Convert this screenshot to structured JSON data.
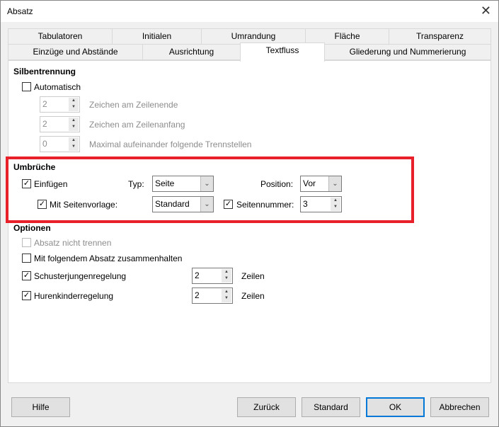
{
  "window": {
    "title": "Absatz",
    "close": "✕"
  },
  "tabs_row1": [
    "Tabulatoren",
    "Initialen",
    "Umrandung",
    "Fläche",
    "Transparenz"
  ],
  "tabs_row2": [
    "Einzüge und Abstände",
    "Ausrichtung",
    "Textfluss",
    "Gliederung und Nummerierung"
  ],
  "silbentrennung": {
    "title": "Silbentrennung",
    "automatisch": "Automatisch",
    "end_value": "2",
    "end_label": "Zeichen am Zeilenende",
    "start_value": "2",
    "start_label": "Zeichen am Zeilenanfang",
    "max_value": "0",
    "max_label": "Maximal aufeinander folgende Trennstellen"
  },
  "umbrueche": {
    "title": "Umbrüche",
    "einfuegen": "Einfügen",
    "typ_label": "Typ:",
    "typ_value": "Seite",
    "position_label": "Position:",
    "position_value": "Vor",
    "seitenvorlage_label": "Mit Seitenvorlage:",
    "seitenvorlage_value": "Standard",
    "seitennummer_label": "Seitennummer:",
    "seitennummer_value": "3"
  },
  "optionen": {
    "title": "Optionen",
    "nicht_trennen": "Absatz nicht trennen",
    "zusammenhalten": "Mit folgendem Absatz zusammenhalten",
    "schuster": "Schusterjungenregelung",
    "schuster_value": "2",
    "huren": "Hurenkinderregelung",
    "huren_value": "2",
    "zeilen": "Zeilen"
  },
  "buttons": {
    "hilfe": "Hilfe",
    "zurueck": "Zurück",
    "standard": "Standard",
    "ok": "OK",
    "abbrechen": "Abbrechen"
  },
  "accent": "#0078d7",
  "highlight": "#e8202a"
}
